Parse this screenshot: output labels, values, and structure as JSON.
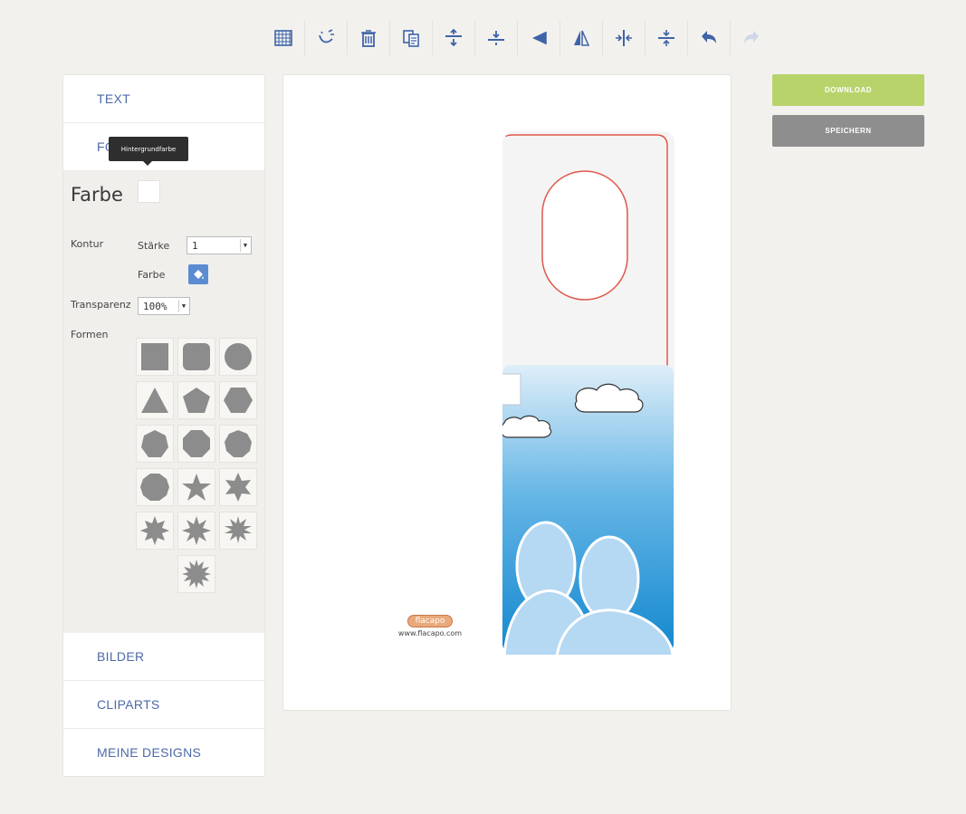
{
  "toolbar": {
    "buttons": [
      {
        "icon": "grid-icon"
      },
      {
        "icon": "magic-wand-icon"
      },
      {
        "icon": "trash-icon"
      },
      {
        "icon": "copy-icon"
      },
      {
        "icon": "align-top-icon"
      },
      {
        "icon": "align-middle-icon"
      },
      {
        "icon": "align-bottom-icon"
      },
      {
        "icon": "flip-horizontal-icon"
      },
      {
        "icon": "center-horizontal-icon"
      },
      {
        "icon": "center-vertical-icon"
      },
      {
        "icon": "undo-icon"
      },
      {
        "icon": "redo-icon"
      }
    ],
    "accent": "#3f63a8"
  },
  "panel": {
    "text_tab": "TEXT",
    "formen_tab": "FORMEN",
    "tooltip": "Hintergrundfarbe",
    "farbe_title": "Farbe",
    "kontur_label": "Kontur",
    "staerke_label": "Stärke",
    "staerke_value": "1",
    "kontur_farbe_label": "Farbe",
    "transparenz_label": "Transparenz",
    "transparenz_value": "100%",
    "formen_label": "Formen",
    "bilder_tab": "BILDER",
    "cliparts_tab": "CLIPARTS",
    "designs_tab": "MEINE DESIGNS",
    "shapes": [
      "square",
      "rounded-square",
      "circle",
      "triangle",
      "pentagon",
      "hexagon",
      "heptagon",
      "octagon",
      "nonagon",
      "decagon",
      "star-5",
      "star-6",
      "star-7",
      "star-8",
      "star-9",
      "star-10"
    ]
  },
  "canvas": {
    "logo_text": "flacapo",
    "logo_url": "www.flacapo.com"
  },
  "actions": {
    "download": "DOWNLOAD",
    "save": "SPEICHERN"
  },
  "colors": {
    "download": "#b9d36b",
    "save": "#8e8e8e",
    "link": "#4d6aa8",
    "cut_line": "#e0564a"
  }
}
